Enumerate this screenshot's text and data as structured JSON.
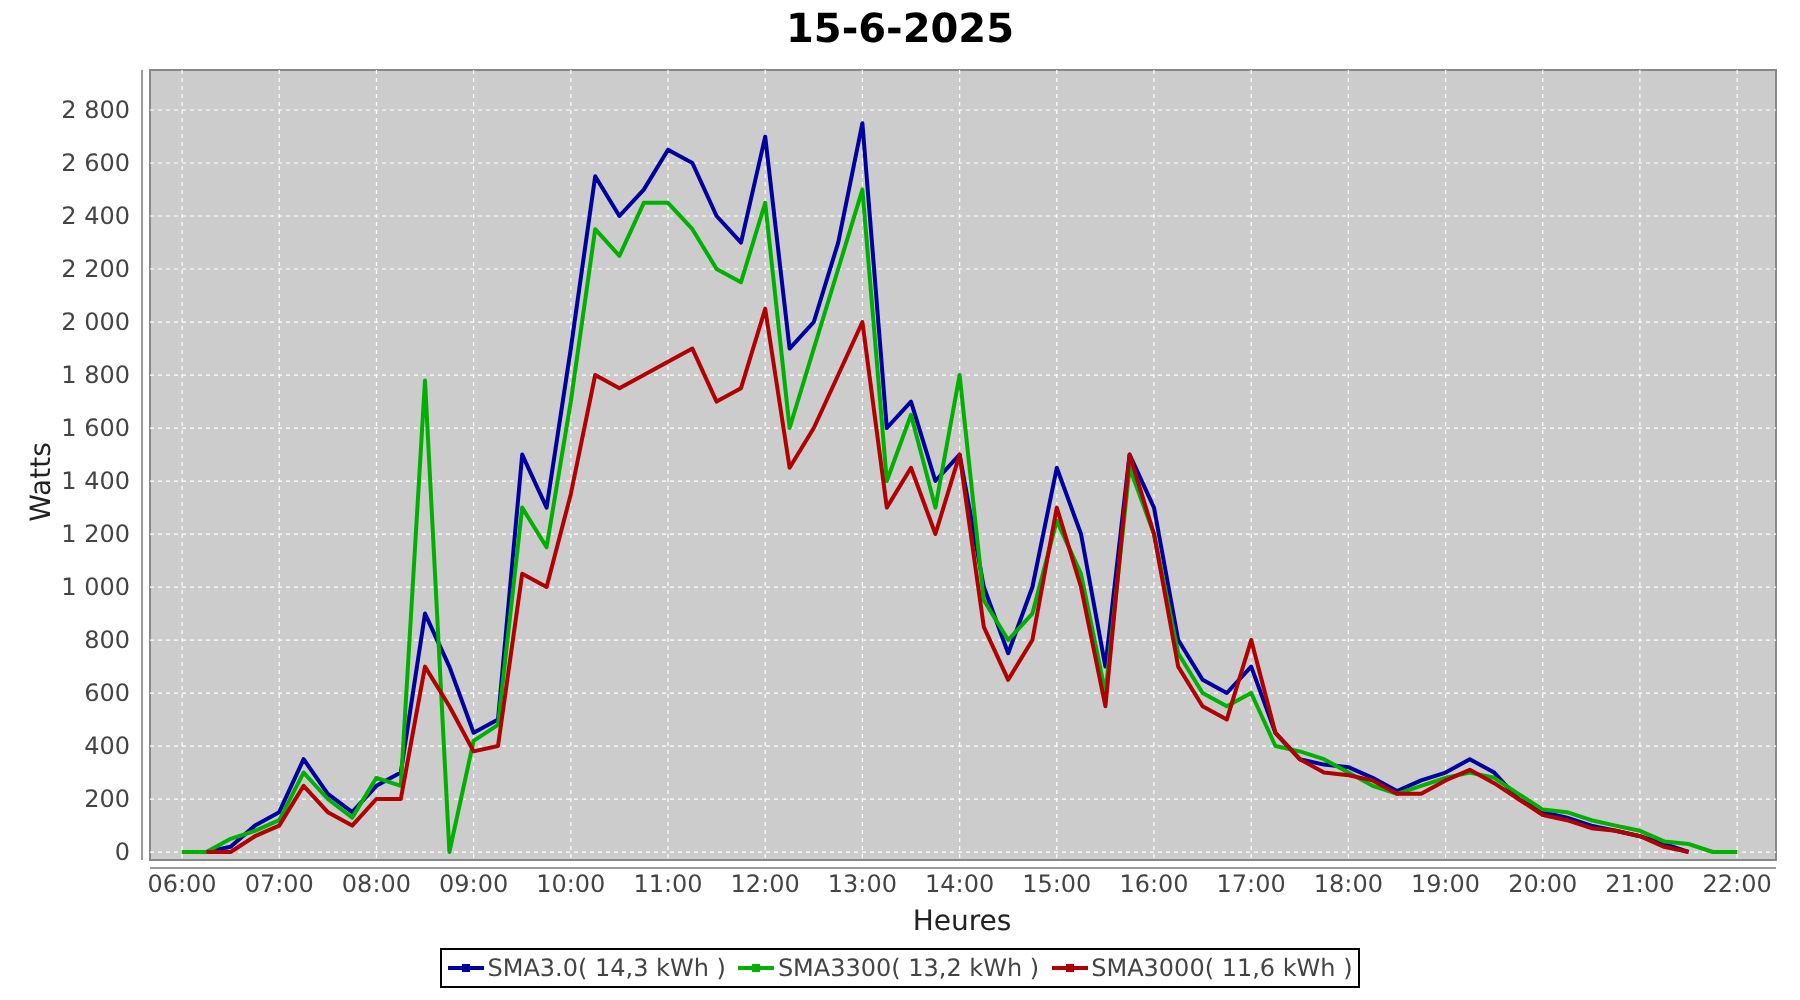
{
  "title": "15-6-2025",
  "chart_data": {
    "type": "line",
    "grid": true,
    "xlabel": "Heures",
    "ylabel": "Watts",
    "xlim": [
      5.67,
      22.4
    ],
    "ylim": [
      -30,
      2951
    ],
    "x": [
      6,
      6.25,
      6.5,
      6.75,
      7,
      7.25,
      7.5,
      7.75,
      8,
      8.25,
      8.5,
      8.75,
      9,
      9.25,
      9.5,
      9.75,
      10,
      10.25,
      10.5,
      10.75,
      11,
      11.25,
      11.5,
      11.75,
      12,
      12.25,
      12.5,
      12.75,
      13,
      13.25,
      13.5,
      13.75,
      14,
      14.25,
      14.5,
      14.75,
      15,
      15.25,
      15.5,
      15.75,
      16,
      16.25,
      16.5,
      16.75,
      17,
      17.25,
      17.5,
      17.75,
      18,
      18.25,
      18.5,
      18.75,
      19,
      19.25,
      19.5,
      19.75,
      20,
      20.25,
      20.5,
      20.75,
      21,
      21.25,
      21.5,
      21.75,
      22
    ],
    "xticks": [
      {
        "value": 6,
        "label": "06:00"
      },
      {
        "value": 7,
        "label": "07:00"
      },
      {
        "value": 8,
        "label": "08:00"
      },
      {
        "value": 9,
        "label": "09:00"
      },
      {
        "value": 10,
        "label": "10:00"
      },
      {
        "value": 11,
        "label": "11:00"
      },
      {
        "value": 12,
        "label": "12:00"
      },
      {
        "value": 13,
        "label": "13:00"
      },
      {
        "value": 14,
        "label": "14:00"
      },
      {
        "value": 15,
        "label": "15:00"
      },
      {
        "value": 16,
        "label": "16:00"
      },
      {
        "value": 17,
        "label": "17:00"
      },
      {
        "value": 18,
        "label": "18:00"
      },
      {
        "value": 19,
        "label": "19:00"
      },
      {
        "value": 20,
        "label": "20:00"
      },
      {
        "value": 21,
        "label": "21:00"
      },
      {
        "value": 22,
        "label": "22:00"
      }
    ],
    "yticks": [
      {
        "value": 0,
        "label": "0"
      },
      {
        "value": 200,
        "label": "200"
      },
      {
        "value": 400,
        "label": "400"
      },
      {
        "value": 600,
        "label": "600"
      },
      {
        "value": 800,
        "label": "800"
      },
      {
        "value": 1000,
        "label": "1 000"
      },
      {
        "value": 1200,
        "label": "1 200"
      },
      {
        "value": 1400,
        "label": "1 400"
      },
      {
        "value": 1600,
        "label": "1 600"
      },
      {
        "value": 1800,
        "label": "1 800"
      },
      {
        "value": 2000,
        "label": "2 000"
      },
      {
        "value": 2200,
        "label": "2 200"
      },
      {
        "value": 2400,
        "label": "2 400"
      },
      {
        "value": 2600,
        "label": "2 600"
      },
      {
        "value": 2800,
        "label": "2 800"
      }
    ],
    "series": [
      {
        "name": "SMA3.0( 14,3 kWh )",
        "color": "#0000a0",
        "values": [
          null,
          0,
          20,
          100,
          150,
          350,
          220,
          150,
          250,
          300,
          900,
          700,
          450,
          500,
          1500,
          1300,
          1900,
          2550,
          2400,
          2500,
          2650,
          2600,
          2400,
          2300,
          2700,
          1900,
          2000,
          2300,
          2750,
          1600,
          1700,
          1400,
          1500,
          1000,
          750,
          1000,
          1450,
          1200,
          700,
          1500,
          1300,
          800,
          650,
          600,
          700,
          450,
          350,
          330,
          320,
          280,
          230,
          270,
          300,
          350,
          300,
          200,
          150,
          130,
          100,
          80,
          60,
          30,
          0,
          null,
          null
        ]
      },
      {
        "name": "SMA3300( 13,2 kWh )",
        "color": "#00b000",
        "values": [
          0,
          0,
          50,
          80,
          120,
          300,
          200,
          130,
          280,
          250,
          1780,
          0,
          420,
          480,
          1300,
          1150,
          1700,
          2350,
          2250,
          2450,
          2450,
          2350,
          2200,
          2150,
          2450,
          1600,
          1900,
          2200,
          2500,
          1400,
          1650,
          1300,
          1800,
          950,
          800,
          900,
          1250,
          1050,
          600,
          1450,
          1200,
          750,
          600,
          550,
          600,
          400,
          380,
          350,
          300,
          250,
          220,
          250,
          280,
          300,
          280,
          220,
          160,
          150,
          120,
          100,
          80,
          40,
          30,
          0,
          0
        ]
      },
      {
        "name": "SMA3000( 11,6 kWh )",
        "color": "#b00000",
        "values": [
          null,
          0,
          0,
          60,
          100,
          250,
          150,
          100,
          200,
          200,
          700,
          550,
          380,
          400,
          1050,
          1000,
          1350,
          1800,
          1750,
          1800,
          1850,
          1900,
          1700,
          1750,
          2050,
          1450,
          1600,
          1800,
          2000,
          1300,
          1450,
          1200,
          1500,
          850,
          650,
          800,
          1300,
          1000,
          550,
          1500,
          1200,
          700,
          550,
          500,
          800,
          450,
          350,
          300,
          290,
          270,
          220,
          220,
          270,
          310,
          260,
          200,
          140,
          120,
          90,
          80,
          60,
          20,
          0,
          null,
          null
        ]
      }
    ]
  }
}
